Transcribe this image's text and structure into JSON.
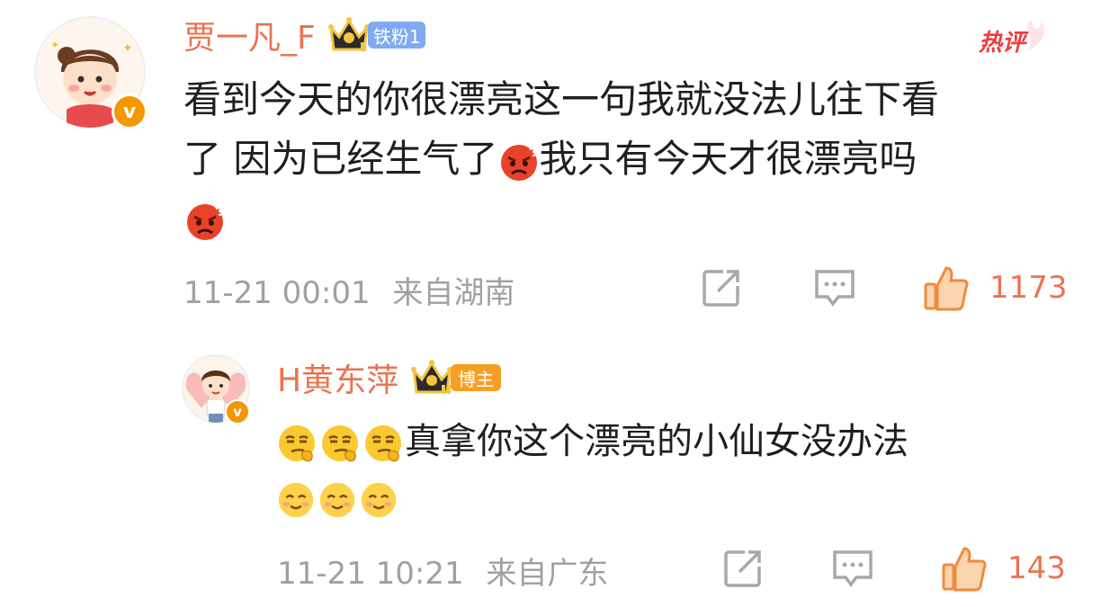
{
  "hot_label": "热评",
  "comments": [
    {
      "username": "贾一凡_F",
      "badge": "铁粉1",
      "text_line1": "看到今天的你很漂亮这一句我就没法儿往下看",
      "text_line2a": "了 因为已经生气了",
      "text_line2b": "我只有今天才很漂亮吗",
      "time": "11-21 00:01",
      "location": "来自湖南",
      "likes": "1173"
    },
    {
      "username": "H黄东萍",
      "badge": "博主",
      "text_line1": "真拿你这个漂亮的小仙女没办法",
      "time": "11-21 10:21",
      "location": "来自广东",
      "likes": "143"
    }
  ],
  "colors": {
    "username": "#eb7350",
    "fan_badge": "#7fa9f0",
    "blogger_badge": "#f5a023",
    "meta": "#a0a0a0",
    "like": "#f08a3c"
  }
}
